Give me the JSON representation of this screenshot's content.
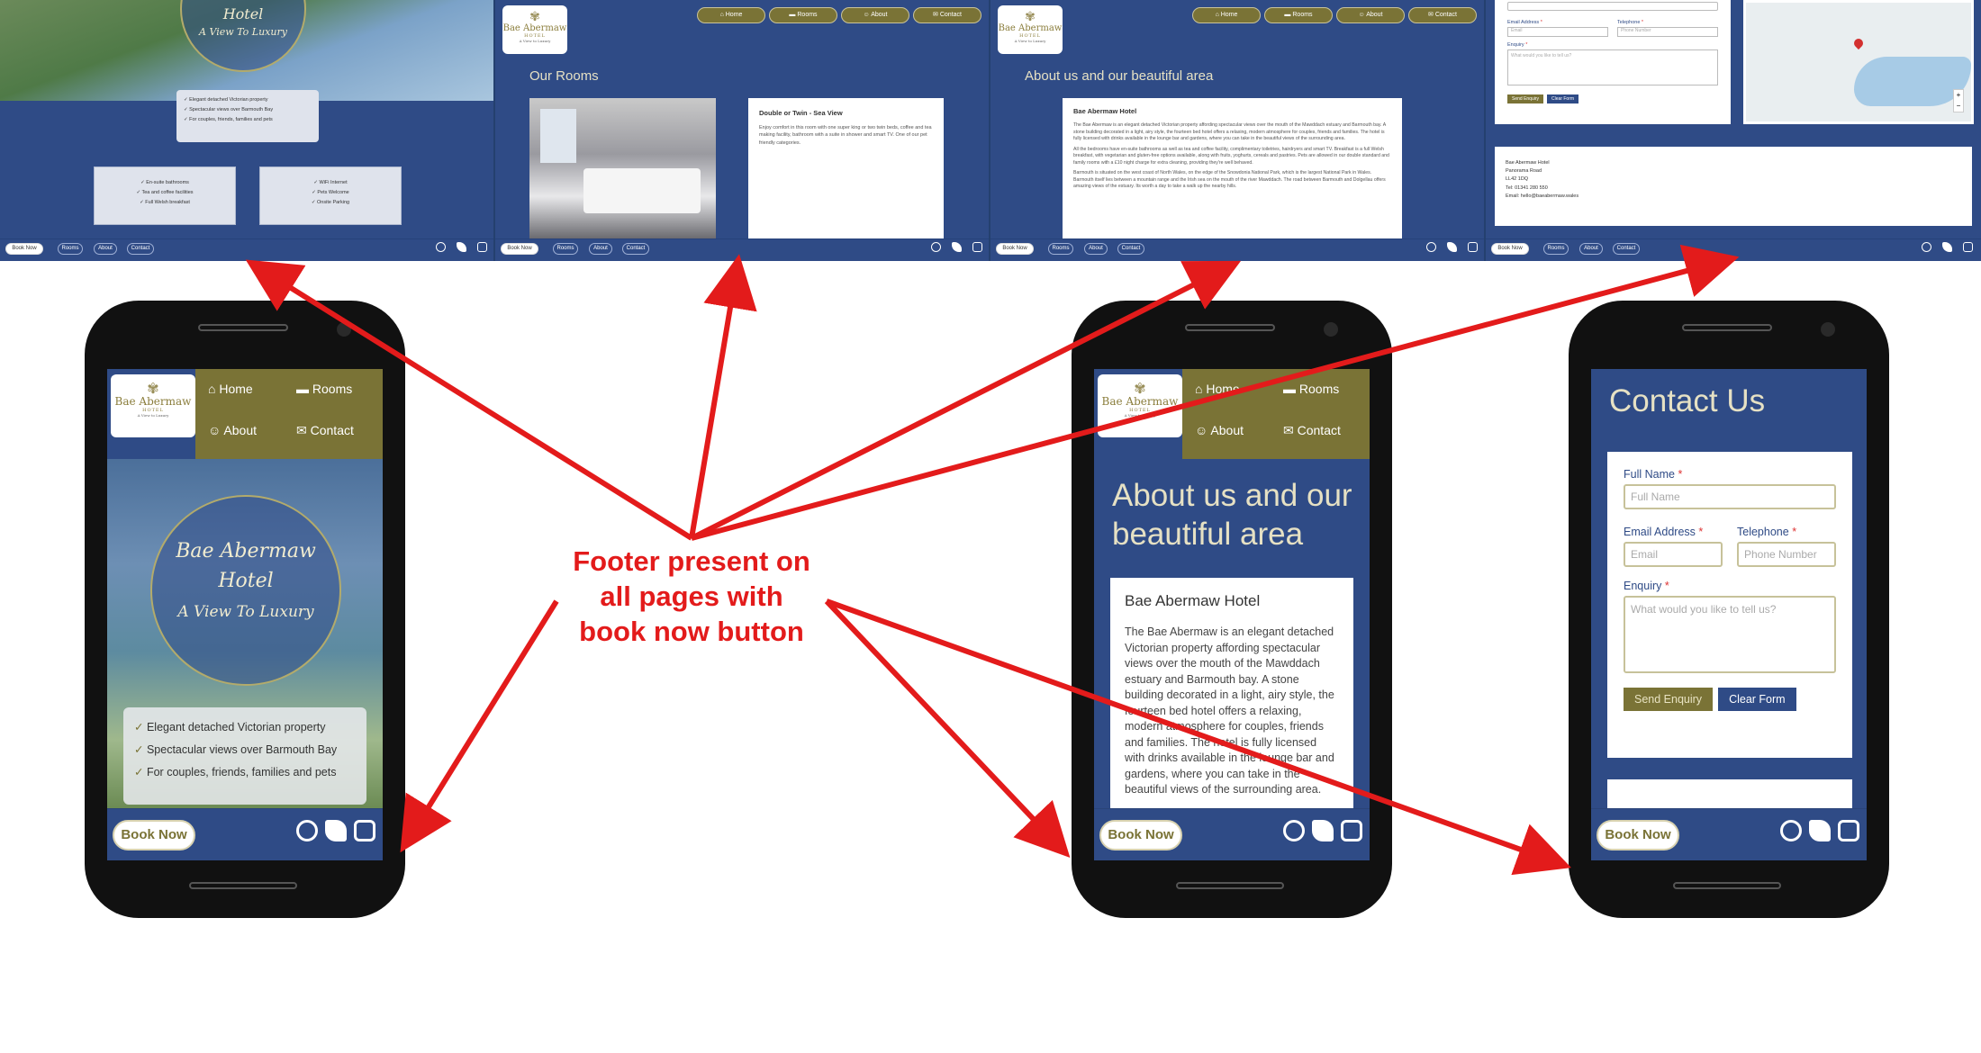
{
  "brand": {
    "name": "Bae Abermaw",
    "sub": "HOTEL",
    "tagline": "A View to Luxury",
    "crest": "✾"
  },
  "colors": {
    "navy": "#2f4b86",
    "olive": "#7a7336",
    "arrow": "#e31b1b"
  },
  "nav": {
    "home": "Home",
    "rooms": "Rooms",
    "about": "About",
    "contact": "Contact"
  },
  "footer": {
    "book": "Book Now",
    "links": [
      "Rooms",
      "About",
      "Contact"
    ],
    "icons": [
      "facebook-icon",
      "twitter-icon",
      "instagram-icon"
    ]
  },
  "home": {
    "hero_line1": "Hotel",
    "hero_line2": "A View To Luxury",
    "hero_full": "Bae Abermaw",
    "features": [
      "Elegant detached Victorian property",
      "Spectacular views over Barmouth Bay",
      "For couples, friends, families and pets"
    ],
    "amenities_left": [
      "En-suite bathrooms",
      "Tea and coffee facilities",
      "Full Welsh breakfast"
    ],
    "amenities_right": [
      "WiFi Internet",
      "Pets Welcome",
      "Onsite Parking"
    ]
  },
  "rooms": {
    "title": "Our Rooms",
    "card_title": "Double or Twin - Sea View",
    "card_text": "Enjoy comfort in this room with one super king or two twin beds, coffee and tea making facility, bathroom with a suite in shower and smart TV. One of our pet friendly categories."
  },
  "about": {
    "title": "About us and our beautiful area",
    "card_title": "Bae Abermaw Hotel",
    "p1": "The Bae Abermaw is an elegant detached Victorian property affording spectacular views over the mouth of the Mawddach estuary and Barmouth bay. A stone building decorated in a light, airy style, the fourteen bed hotel offers a relaxing, modern atmosphere for couples, friends and families. The hotel is fully licensed with drinks available in the lounge bar and gardens, where you can take in the beautiful views of the surrounding area.",
    "p2": "All the bedrooms have en-suite bathrooms as well as tea and coffee facility, complimentary toiletries, hairdryers and smart TV. Breakfast is a full Welsh breakfast, with vegetarian and gluten-free options available, along with fruits, yoghurts, cereals and pastries. Pets are allowed in our double standard and family rooms with a £10 night charge for extra cleaning, providing they're well behaved.",
    "p3": "Barmouth is situated on the west coast of North Wales, on the edge of the Snowdonia National Park, which is the largest National Park in Wales. Barmouth itself lies between a mountain range and the Irish sea on the mouth of the river Mawddach. The road between Barmouth and Dolgellau offers amazing views of the estuary. Its worth a day to take a walk up the nearby hills."
  },
  "contact": {
    "title": "Contact Us",
    "full_name": "Full Name",
    "full_name_ph": "Full Name",
    "email": "Email Address",
    "email_ph": "Email",
    "phone": "Telephone",
    "phone_ph": "Phone Number",
    "enquiry": "Enquiry",
    "enquiry_ph": "What would you like to tell us?",
    "send": "Send Enquiry",
    "clear": "Clear Form",
    "address": [
      "Bae Abermaw Hotel",
      "Panorama Road",
      "LL42 1DQ"
    ],
    "tel": "Tel: 01341 280 550",
    "email_addr": "Email: hello@baeabermaw.wales"
  },
  "callout": {
    "line1": "Footer present on",
    "line2": "all pages with",
    "line3": "book now button"
  }
}
